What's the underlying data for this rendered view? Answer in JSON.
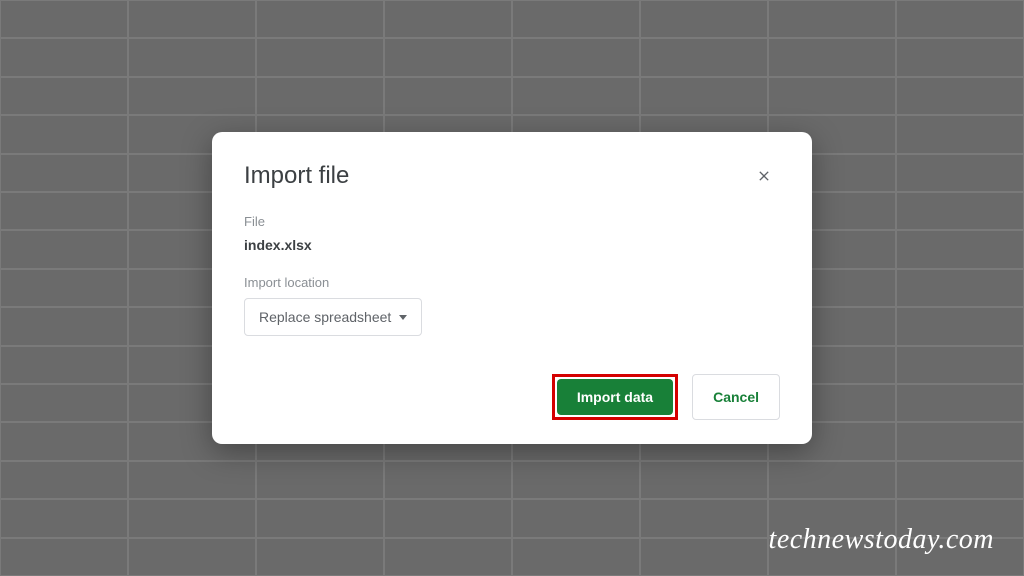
{
  "dialog": {
    "title": "Import file",
    "file_label": "File",
    "file_name": "index.xlsx",
    "location_label": "Import location",
    "location_selected": "Replace spreadsheet",
    "primary_label": "Import data",
    "secondary_label": "Cancel"
  },
  "watermark": "technewstoday.com",
  "colors": {
    "primary_btn_bg": "#188038",
    "highlight_border": "#d40000",
    "dialog_text": "#3c4043"
  }
}
